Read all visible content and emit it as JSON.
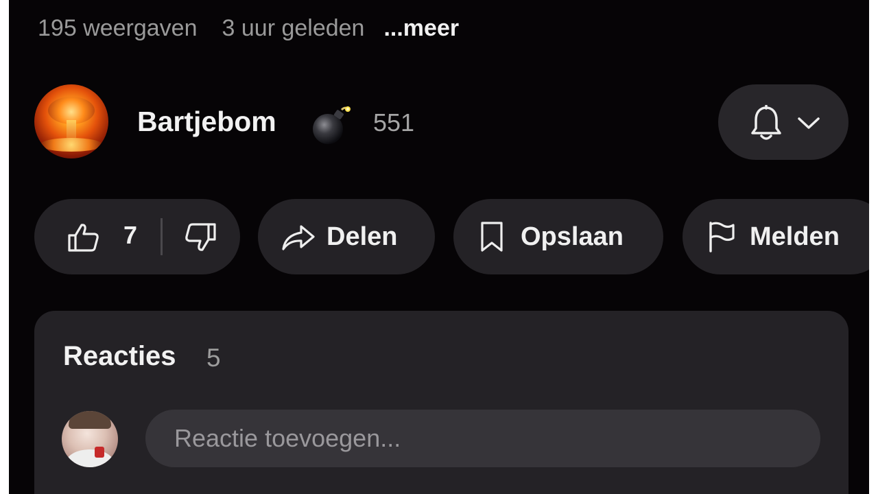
{
  "video_meta": {
    "views": "195 weergaven",
    "time_ago": "3 uur geleden",
    "more_label": "...meer"
  },
  "channel": {
    "name": "Bartjebom",
    "subscriber_count": "551",
    "badge_icon": "bomb-icon",
    "bell_icon": "bell-icon",
    "dropdown_icon": "chevron-down-icon"
  },
  "actions": {
    "like_count": "7",
    "share_label": "Delen",
    "save_label": "Opslaan",
    "report_label": "Melden"
  },
  "comments": {
    "title": "Reacties",
    "count": "5",
    "input_placeholder": "Reactie toevoegen..."
  },
  "colors": {
    "background": "#060406",
    "pill": "#242226",
    "input": "#363439",
    "text_primary": "#f2f2f2",
    "text_secondary": "#9a9a9a"
  }
}
